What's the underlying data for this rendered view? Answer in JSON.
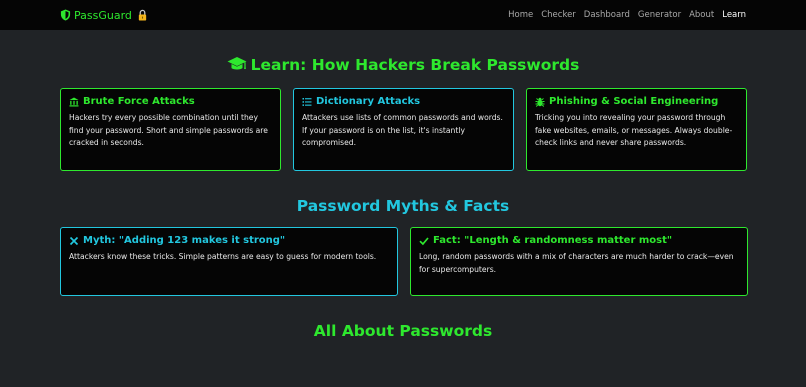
{
  "nav": {
    "brand": "PassGuard",
    "links": [
      "Home",
      "Checker",
      "Dashboard",
      "Generator",
      "About",
      "Learn"
    ],
    "active": "Learn"
  },
  "learn": {
    "title": "Learn: How Hackers Break Passwords",
    "cards": [
      {
        "title": "Brute Force Attacks",
        "text": "Hackers try every possible combination until they find your password. Short and simple passwords are cracked in seconds."
      },
      {
        "title": "Dictionary Attacks",
        "text": "Attackers use lists of common passwords and words. If your password is on the list, it's instantly compromised."
      },
      {
        "title": "Phishing & Social Engineering",
        "text": "Tricking you into revealing your password through fake websites, emails, or messages. Always double-check links and never share passwords."
      }
    ]
  },
  "myths": {
    "title": "Password Myths & Facts",
    "myth": {
      "title": "Myth: \"Adding 123 makes it strong\"",
      "text": "Attackers know these tricks. Simple patterns are easy to guess for modern tools."
    },
    "fact": {
      "title": "Fact: \"Length & randomness matter most\"",
      "text": "Long, random passwords with a mix of characters are much harder to crack—even for supercomputers."
    }
  },
  "about": {
    "title": "All About Passwords"
  },
  "colors": {
    "accent_green": "#2ee82e",
    "accent_cyan": "#22c7df",
    "card_bg": "#050505",
    "page_bg": "#202326"
  }
}
